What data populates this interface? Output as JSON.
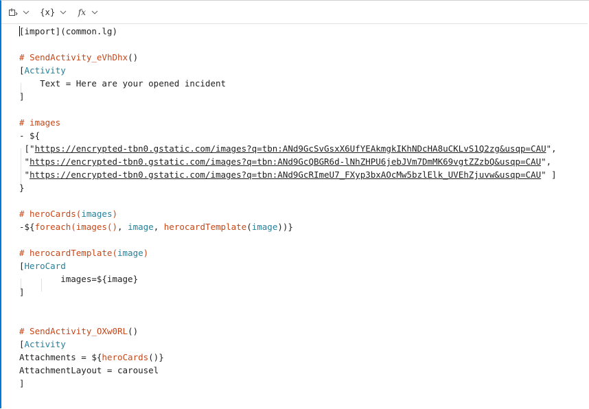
{
  "toolbar": {
    "insert_icon": "insert-template-icon",
    "variables_label": "{x}",
    "functions_label": "fx"
  },
  "code_lines": [
    {
      "segments": [
        {
          "t": "[import](common.lg)",
          "c": "plain"
        }
      ]
    },
    {
      "segments": []
    },
    {
      "segments": [
        {
          "t": "# ",
          "c": "comment"
        },
        {
          "t": "SendActivity_eVhDhx",
          "c": "comment"
        },
        {
          "t": "()",
          "c": "plain"
        }
      ]
    },
    {
      "segments": [
        {
          "t": "[",
          "c": "plain"
        },
        {
          "t": "Activity",
          "c": "kw"
        }
      ]
    },
    {
      "segments": [
        {
          "t": "    Text = Here are your opened incident",
          "c": "plain"
        }
      ]
    },
    {
      "segments": [
        {
          "t": "]",
          "c": "plain"
        }
      ]
    },
    {
      "segments": []
    },
    {
      "segments": [
        {
          "t": "# images",
          "c": "comment"
        }
      ]
    },
    {
      "segments": [
        {
          "t": "- ${",
          "c": "plain"
        }
      ]
    },
    {
      "segments": [
        {
          "t": " [\"",
          "c": "plain"
        },
        {
          "t": "https://encrypted-tbn0.gstatic.com/images?q=tbn:ANd9GcSvGsxX6UfYEAkmgkIKhNDcHA8uCKLvS1Q2zg&usqp=CAU",
          "c": "link"
        },
        {
          "t": "\",",
          "c": "plain"
        }
      ]
    },
    {
      "segments": [
        {
          "t": " \"",
          "c": "plain"
        },
        {
          "t": "https://encrypted-tbn0.gstatic.com/images?q=tbn:ANd9GcQBGR6d-lNhZHPU6jebJVm7DmMK69vgtZZzbQ&usqp=CAU",
          "c": "link"
        },
        {
          "t": "\",",
          "c": "plain"
        }
      ]
    },
    {
      "segments": [
        {
          "t": " \"",
          "c": "plain"
        },
        {
          "t": "https://encrypted-tbn0.gstatic.com/images?q=tbn:ANd9GcRImeU7_FXyp3bxAOcMw5bzlElk_UVEhZjuvw&usqp=CAU",
          "c": "link"
        },
        {
          "t": "\" ]",
          "c": "plain"
        }
      ]
    },
    {
      "segments": [
        {
          "t": "}",
          "c": "plain"
        }
      ]
    },
    {
      "segments": []
    },
    {
      "segments": [
        {
          "t": "# heroCards(",
          "c": "comment"
        },
        {
          "t": "images",
          "c": "kw"
        },
        {
          "t": ")",
          "c": "comment"
        }
      ]
    },
    {
      "segments": [
        {
          "t": "-${",
          "c": "plain"
        },
        {
          "t": "foreach(images()",
          "c": "fn"
        },
        {
          "t": ", ",
          "c": "plain"
        },
        {
          "t": "image",
          "c": "kw"
        },
        {
          "t": ", ",
          "c": "plain"
        },
        {
          "t": "herocardTemplate",
          "c": "fn"
        },
        {
          "t": "(",
          "c": "plain"
        },
        {
          "t": "image",
          "c": "kw"
        },
        {
          "t": "))}",
          "c": "plain"
        }
      ]
    },
    {
      "segments": []
    },
    {
      "segments": [
        {
          "t": "# herocardTemplate(",
          "c": "comment"
        },
        {
          "t": "image",
          "c": "kw"
        },
        {
          "t": ")",
          "c": "comment"
        }
      ]
    },
    {
      "segments": [
        {
          "t": "[",
          "c": "plain"
        },
        {
          "t": "HeroCard",
          "c": "kw"
        }
      ]
    },
    {
      "segments": [
        {
          "t": "        images=${image}",
          "c": "plain"
        }
      ]
    },
    {
      "segments": [
        {
          "t": "]",
          "c": "plain"
        }
      ]
    },
    {
      "segments": []
    },
    {
      "segments": []
    },
    {
      "segments": [
        {
          "t": "# SendActivity_OXw0RL",
          "c": "comment"
        },
        {
          "t": "()",
          "c": "plain"
        }
      ]
    },
    {
      "segments": [
        {
          "t": "[",
          "c": "plain"
        },
        {
          "t": "Activity",
          "c": "kw"
        }
      ]
    },
    {
      "segments": [
        {
          "t": "Attachments = ${",
          "c": "plain"
        },
        {
          "t": "heroCards",
          "c": "fn"
        },
        {
          "t": "()}",
          "c": "plain"
        }
      ]
    },
    {
      "segments": [
        {
          "t": "AttachmentLayout = carousel",
          "c": "plain"
        }
      ]
    },
    {
      "segments": [
        {
          "t": "]",
          "c": "plain"
        }
      ]
    }
  ]
}
